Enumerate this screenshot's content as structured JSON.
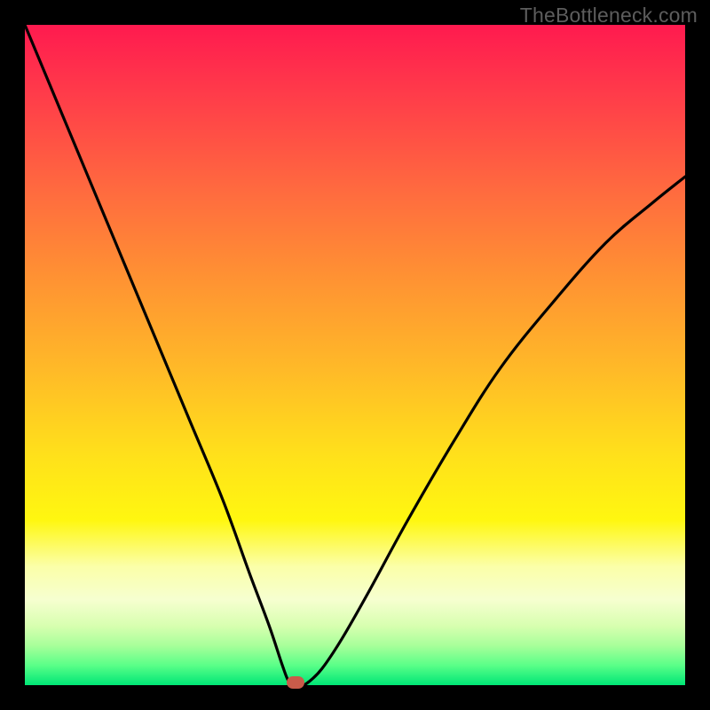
{
  "watermark": "TheBottleneck.com",
  "colors": {
    "background": "#000000",
    "gradient_top": "#ff1a4f",
    "gradient_bottom": "#00e676",
    "curve": "#000000",
    "marker": "#c95b4a"
  },
  "chart_data": {
    "type": "line",
    "title": "",
    "xlabel": "",
    "ylabel": "",
    "xlim": [
      0,
      100
    ],
    "ylim": [
      0,
      100
    ],
    "grid": false,
    "legend": false,
    "annotations": [],
    "marker": {
      "x": 41,
      "y": 0
    },
    "series": [
      {
        "name": "bottleneck-curve",
        "x": [
          0,
          5,
          10,
          15,
          20,
          25,
          30,
          34,
          37,
          39,
          40,
          41,
          42,
          43,
          45,
          48,
          52,
          58,
          65,
          72,
          80,
          88,
          95,
          100
        ],
        "y": [
          100,
          88,
          76,
          64,
          52,
          40,
          28,
          17,
          9,
          3,
          0.5,
          0,
          0,
          0.5,
          2.5,
          7,
          14,
          25,
          37,
          48,
          58,
          67,
          73,
          77
        ]
      }
    ]
  }
}
